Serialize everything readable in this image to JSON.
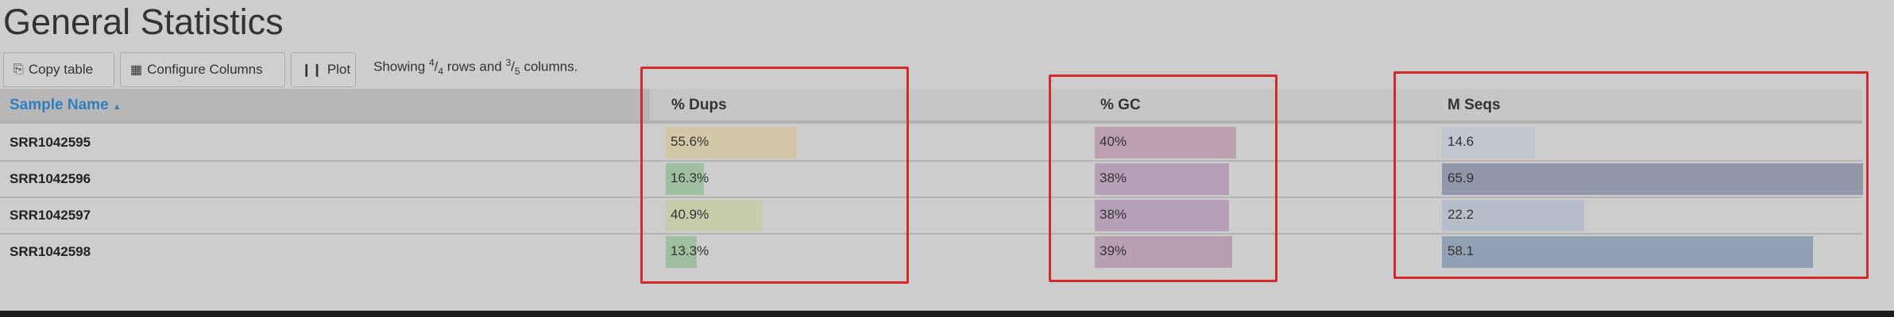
{
  "page": {
    "title": "General Statistics"
  },
  "toolbar": {
    "copy_label": "Copy table",
    "configure_label": "Configure Columns",
    "plot_label": "Plot",
    "showing_prefix": "Showing ",
    "rows_shown": "4",
    "rows_total": "4",
    "rows_mid": " rows and ",
    "cols_shown": "3",
    "cols_total": "5",
    "cols_suffix": " columns."
  },
  "table": {
    "headers": {
      "sample": "Sample Name",
      "sort_indicator": "▲",
      "dups": "% Dups",
      "gc": "% GC",
      "mseqs": "M Seqs"
    },
    "rows": [
      {
        "name": "SRR1042595",
        "dups": "55.6%",
        "gc": "40%",
        "mseqs": "14.6"
      },
      {
        "name": "SRR1042596",
        "dups": "16.3%",
        "gc": "38%",
        "mseqs": "65.9"
      },
      {
        "name": "SRR1042597",
        "dups": "40.9%",
        "gc": "38%",
        "mseqs": "22.2"
      },
      {
        "name": "SRR1042598",
        "dups": "13.3%",
        "gc": "39%",
        "mseqs": "58.1"
      }
    ],
    "bar_values": {
      "dups": [
        55.6,
        16.3,
        40.9,
        13.3
      ],
      "gc": [
        40,
        38,
        38,
        39
      ],
      "mseqs": [
        14.6,
        65.9,
        22.2,
        58.1
      ]
    },
    "bar_colors": {
      "dups": [
        "#d3c7a8",
        "#9fc0a0",
        "#c4ccaa",
        "#9ec0a0"
      ],
      "gc": [
        "#bba1b0",
        "#b5a0b7",
        "#b5a0b7",
        "#b8a0b3"
      ],
      "mseqs": [
        "#c1c5ce",
        "#8f97a8",
        "#b8bec9",
        "#92a0b4"
      ]
    }
  },
  "colors": {
    "highlight": "#d62a2a",
    "sort_link": "#2f7fc0"
  }
}
